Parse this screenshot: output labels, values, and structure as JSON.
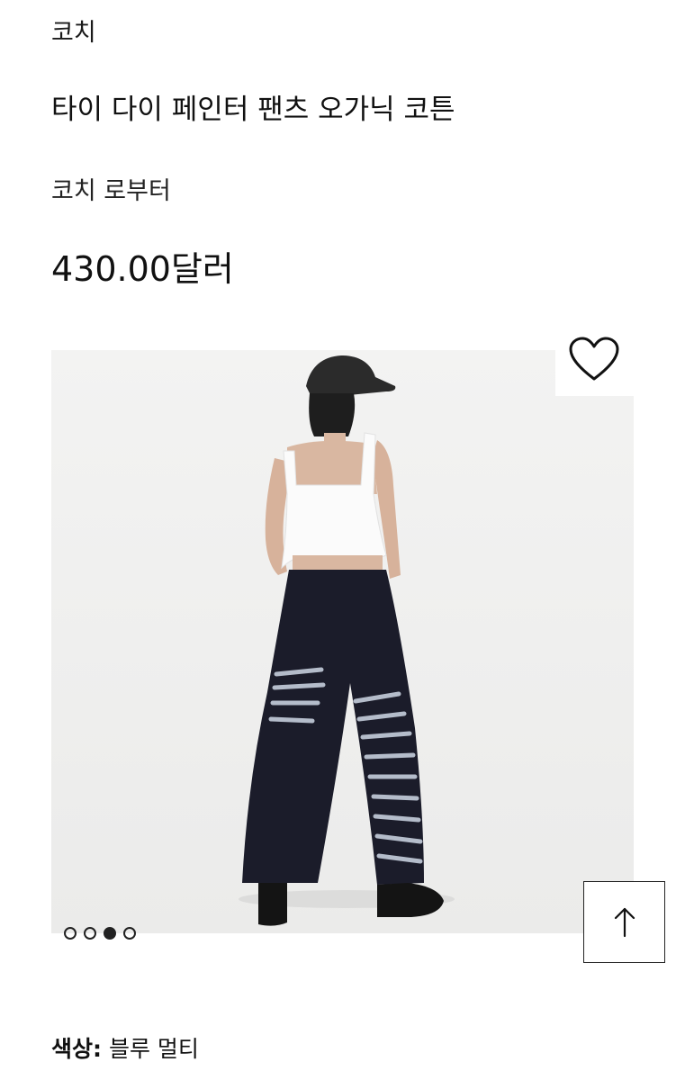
{
  "brand": "코치",
  "product": {
    "title": "타이 다이 페인터 팬츠 오가닉 코튼",
    "collection": "코치 로부터",
    "price": "430.00달러"
  },
  "gallery": {
    "image_description_icon": "product-photo",
    "dots": [
      {
        "active": false
      },
      {
        "active": false
      },
      {
        "active": true
      },
      {
        "active": false
      }
    ]
  },
  "icons": {
    "wishlist": "heart-icon",
    "scroll_top": "arrow-up-icon"
  },
  "color": {
    "label": "색상:",
    "value": "블루 멀티"
  },
  "colors": {
    "text": "#111111",
    "gallery_bg": "#f1f1f0",
    "pants_dark": "#1b1c2a",
    "pants_light": "#cfd8e6"
  }
}
